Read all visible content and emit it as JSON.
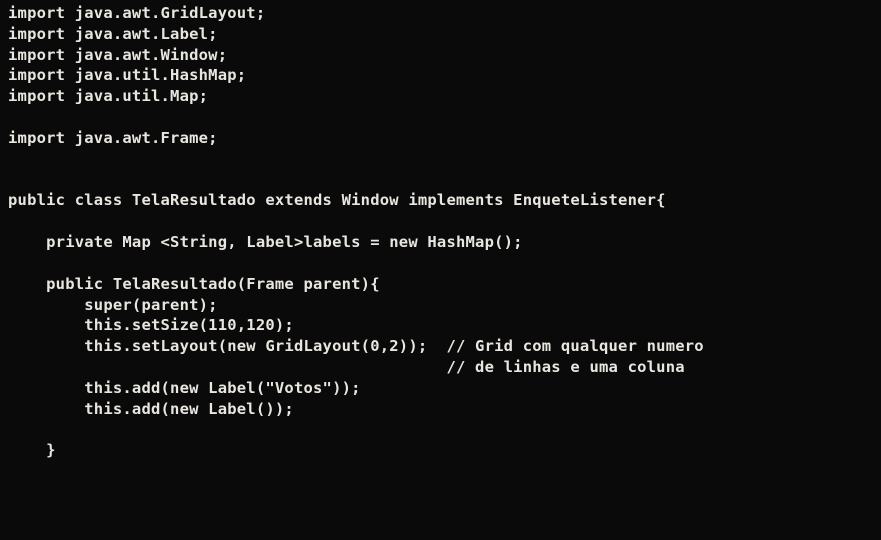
{
  "code": {
    "lines": [
      "import java.awt.GridLayout;",
      "import java.awt.Label;",
      "import java.awt.Window;",
      "import java.util.HashMap;",
      "import java.util.Map;",
      "",
      "import java.awt.Frame;",
      "",
      "",
      "public class TelaResultado extends Window implements EnqueteListener{",
      "",
      "    private Map <String, Label>labels = new HashMap();",
      "",
      "    public TelaResultado(Frame parent){",
      "        super(parent);",
      "        this.setSize(110,120);",
      "        this.setLayout(new GridLayout(0,2));  // Grid com qualquer numero",
      "                                              // de linhas e uma coluna",
      "        this.add(new Label(\"Votos\"));",
      "        this.add(new Label());",
      "",
      "    }"
    ]
  }
}
